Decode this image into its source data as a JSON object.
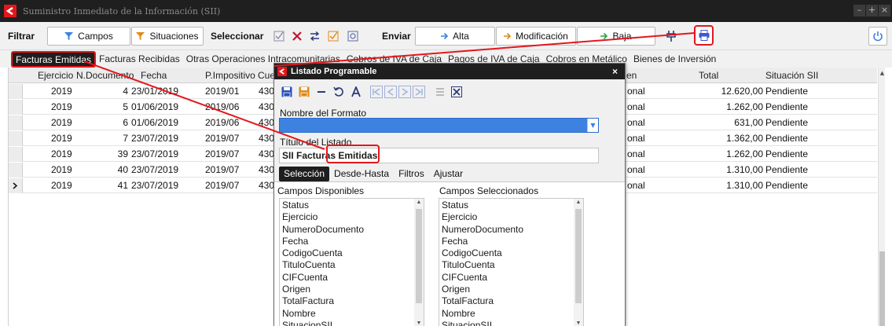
{
  "window": {
    "title": "Suministro Inmediato de la Información (SII)",
    "controls": [
      "–",
      "+",
      "×"
    ]
  },
  "toolbar": {
    "filtrar_label": "Filtrar",
    "campos_label": "Campos",
    "situaciones_label": "Situaciones",
    "seleccionar_label": "Seleccionar",
    "enviar_label": "Enviar",
    "alta_label": "Alta",
    "modificacion_label": "Modificación",
    "baja_label": "Baja"
  },
  "tabs": [
    "Facturas Emitidas",
    "Facturas Recibidas",
    "Otras Operaciones Intracomunitarias",
    "Cobros de IVA de Caja",
    "Pagos de IVA de Caja",
    "Cobros en Metálico",
    "Bienes de Inversión"
  ],
  "grid": {
    "headers": {
      "ejercicio": "Ejercicio",
      "ndocumento": "N.Documento",
      "fecha": "Fecha",
      "pimpositivo": "P.Impositivo",
      "cuenta": "Cuen",
      "origen": "en",
      "total": "Total",
      "situacion": "Situación SII"
    },
    "rows": [
      {
        "ejercicio": "2019",
        "ndoc": "4",
        "fecha": "23/01/2019",
        "periodo": "2019/01",
        "cuenta": "430",
        "origen": "onal",
        "total": "12.620,00",
        "situacion": "Pendiente"
      },
      {
        "ejercicio": "2019",
        "ndoc": "5",
        "fecha": "01/06/2019",
        "periodo": "2019/06",
        "cuenta": "430",
        "origen": "onal",
        "total": "1.262,00",
        "situacion": "Pendiente"
      },
      {
        "ejercicio": "2019",
        "ndoc": "6",
        "fecha": "01/06/2019",
        "periodo": "2019/06",
        "cuenta": "430",
        "origen": "onal",
        "total": "631,00",
        "situacion": "Pendiente"
      },
      {
        "ejercicio": "2019",
        "ndoc": "7",
        "fecha": "23/07/2019",
        "periodo": "2019/07",
        "cuenta": "430",
        "origen": "onal",
        "total": "1.362,00",
        "situacion": "Pendiente"
      },
      {
        "ejercicio": "2019",
        "ndoc": "39",
        "fecha": "23/07/2019",
        "periodo": "2019/07",
        "cuenta": "430",
        "origen": "onal",
        "total": "1.262,00",
        "situacion": "Pendiente"
      },
      {
        "ejercicio": "2019",
        "ndoc": "40",
        "fecha": "23/07/2019",
        "periodo": "2019/07",
        "cuenta": "430",
        "origen": "onal",
        "total": "1.310,00",
        "situacion": "Pendiente"
      },
      {
        "ejercicio": "2019",
        "ndoc": "41",
        "fecha": "23/07/2019",
        "periodo": "2019/07",
        "cuenta": "430",
        "origen": "onal",
        "total": "1.310,00",
        "situacion": "Pendiente"
      }
    ]
  },
  "dialog": {
    "title": "Listado Programable",
    "close": "×",
    "nombre_formato_label": "Nombre del Formato",
    "nombre_formato_value": "",
    "titulo_listado_label": "Título del Listado",
    "titulo_listado_value": "SII Facturas Emitidas",
    "tabs": [
      "Selección",
      "Desde-Hasta",
      "Filtros",
      "Ajustar"
    ],
    "campos_disponibles_label": "Campos Disponibles",
    "campos_seleccionados_label": "Campos Seleccionados",
    "campos_disponibles": [
      "Status",
      "Ejercicio",
      "NumeroDocumento",
      "Fecha",
      "CodigoCuenta",
      "TituloCuenta",
      "CIFCuenta",
      "Origen",
      "TotalFactura",
      "Nombre",
      "SituacionSII"
    ],
    "campos_seleccionados": [
      "Status",
      "Ejercicio",
      "NumeroDocumento",
      "Fecha",
      "CodigoCuenta",
      "TituloCuenta",
      "CIFCuenta",
      "Origen",
      "TotalFactura",
      "Nombre",
      "SituacionSII"
    ]
  },
  "colors": {
    "accent": "#3d82e0",
    "highlight": "#e2171c",
    "titlebar": "#1f1f1f",
    "brand_red": "#e2171c"
  }
}
